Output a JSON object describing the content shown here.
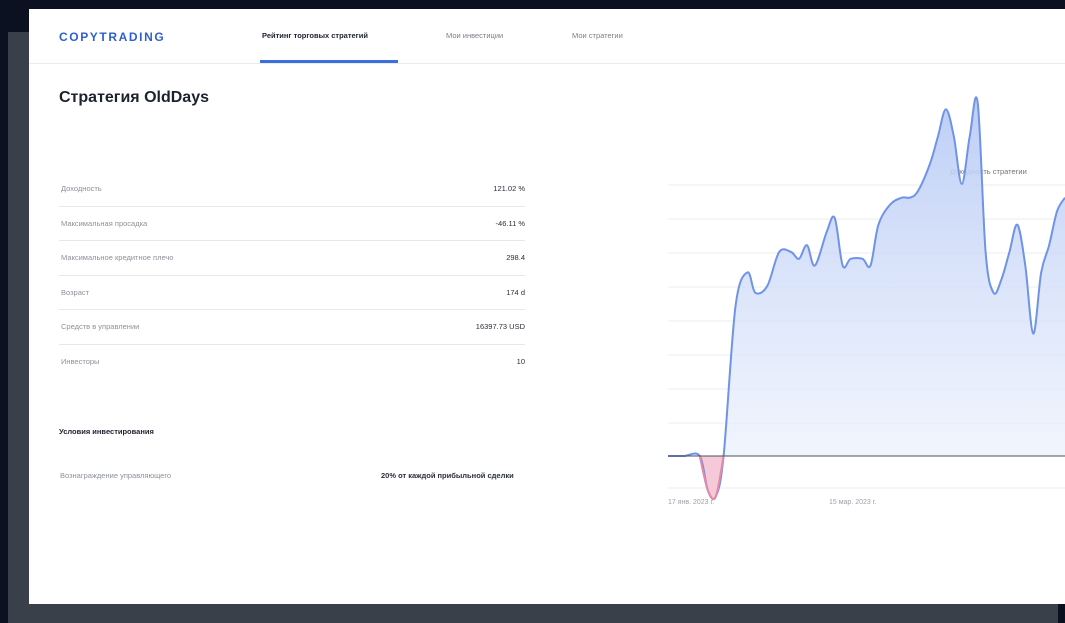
{
  "header": {
    "logo": "COPYTRADING",
    "tabs": [
      {
        "label": "Рейтинг торговых стратегий",
        "active": true
      },
      {
        "label": "Мои инвестиции",
        "active": false
      },
      {
        "label": "Мои стратегии",
        "active": false
      }
    ]
  },
  "page": {
    "title": "Стратегия OldDays"
  },
  "stats": [
    {
      "label": "Доходность",
      "value": "121.02 %"
    },
    {
      "label": "Максимальная просадка",
      "value": "-46.11 %"
    },
    {
      "label": "Максимальное кредитное плечо",
      "value": "298.4"
    },
    {
      "label": "Возраст",
      "value": "174 d"
    },
    {
      "label": "Средств в управлении",
      "value": "16397.73 USD"
    },
    {
      "label": "Инвесторы",
      "value": "10"
    }
  ],
  "conditions": {
    "title": "Условия инвестирования",
    "rows": [
      {
        "label": "Вознаграждение управляющего",
        "value": "20% от каждой прибыльной сделки"
      }
    ]
  },
  "chart_data": {
    "type": "area",
    "title": "Доходность стратегии",
    "xlabel": "",
    "ylabel": "",
    "x_tick_labels": [
      "17 янв. 2023 г.",
      "15 мар. 2023 г."
    ],
    "baseline": 0,
    "grid": true,
    "colors": {
      "positive": "#6f93e6",
      "negative": "#e48aa8",
      "fill": "#cdd9f7"
    },
    "series": [
      {
        "x": [
          0,
          4,
          8,
          10,
          12,
          14,
          17,
          20,
          22,
          25,
          28,
          31,
          33,
          35,
          37,
          40,
          42,
          44,
          46,
          49,
          51,
          53,
          56,
          59,
          61,
          63,
          66,
          68,
          70,
          72,
          74,
          76,
          78,
          80,
          82,
          84,
          86,
          88,
          90,
          92,
          94,
          96,
          98,
          100
        ],
        "values": [
          0,
          0,
          0,
          -5,
          -6,
          0,
          22,
          27,
          24,
          25,
          30,
          30,
          29,
          31,
          28,
          33,
          35,
          28,
          29,
          29,
          28,
          34,
          37,
          38,
          38,
          39,
          43,
          47,
          51,
          47,
          40,
          47,
          52,
          30,
          24,
          26,
          30,
          34,
          28,
          18,
          27,
          31,
          36,
          38
        ]
      }
    ]
  }
}
